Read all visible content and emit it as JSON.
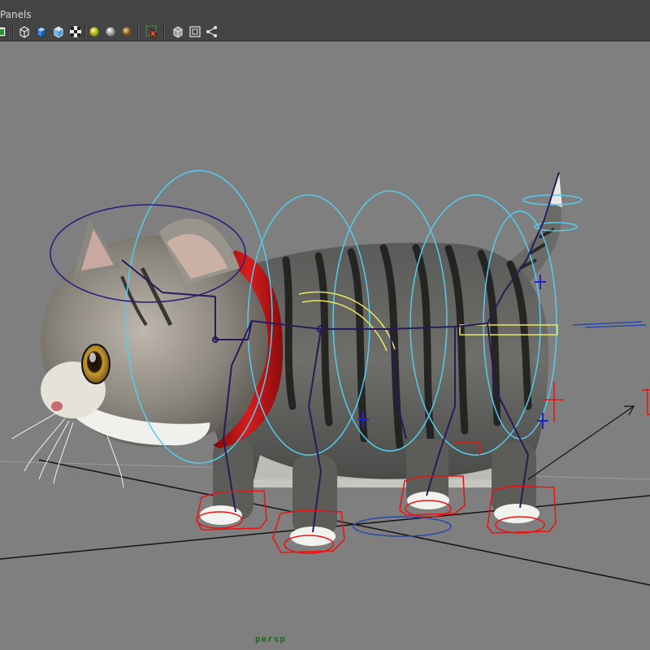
{
  "menubar": {
    "panels_label": "Panels"
  },
  "toolbar": {
    "buttons": [
      {
        "name": "image-plane-icon"
      },
      {
        "name": "wireframe-cube-icon"
      },
      {
        "name": "smooth-shade-cube-icon"
      },
      {
        "name": "flat-shade-cube-icon"
      },
      {
        "name": "textured-checker-icon"
      },
      {
        "name": "default-light-icon"
      },
      {
        "name": "all-lights-icon"
      },
      {
        "name": "shadows-icon"
      },
      {
        "name": "isolate-select-icon"
      },
      {
        "name": "xray-cube-icon"
      },
      {
        "name": "xray-joints-icon"
      },
      {
        "name": "node-graph-icon"
      }
    ]
  },
  "viewport": {
    "camera_label": "persp",
    "background_color": "#7f7f7f",
    "control_color": "#55ccee",
    "joint_color": "#2a1a5a",
    "ik_color": "#ee1111",
    "collar_color": "#c81818"
  }
}
